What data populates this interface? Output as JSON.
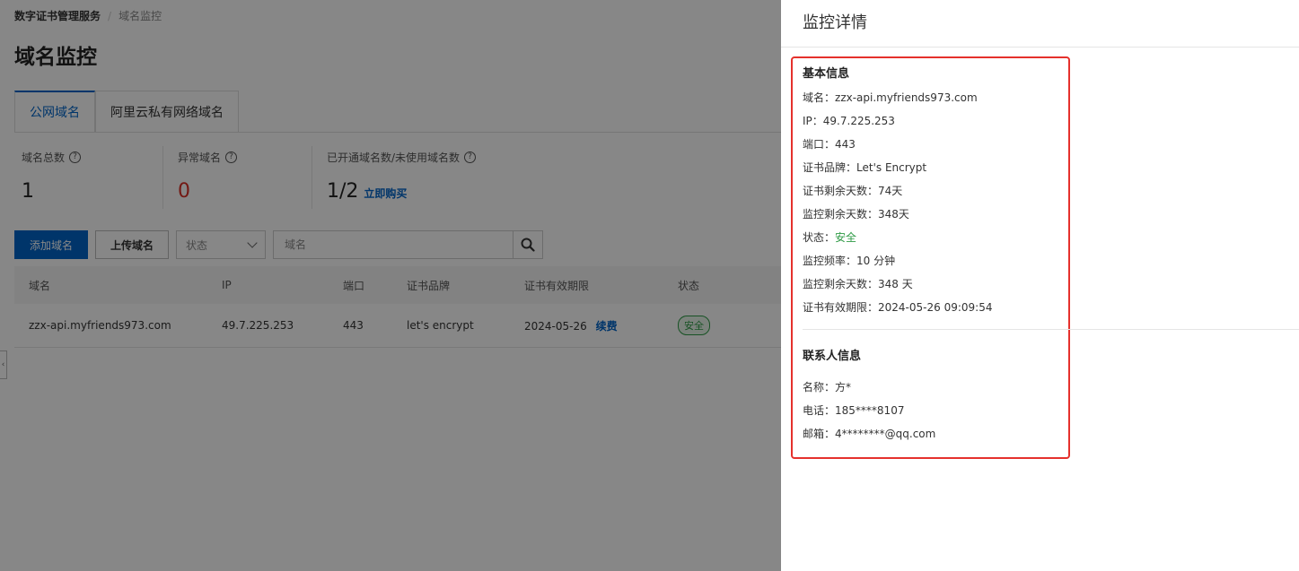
{
  "breadcrumb": {
    "root": "数字证书管理服务",
    "separator": "/",
    "current": "域名监控"
  },
  "page_title": "域名监控",
  "tabs": [
    {
      "label": "公网域名",
      "active": true
    },
    {
      "label": "阿里云私有网络域名",
      "active": false
    }
  ],
  "stats": [
    {
      "label": "域名总数",
      "value": "1"
    },
    {
      "label": "异常域名",
      "value": "0"
    },
    {
      "label": "已开通域名数/未使用域名数",
      "value": "1/2",
      "link": "立即购买"
    }
  ],
  "toolbar": {
    "add_label": "添加域名",
    "upload_label": "上传域名",
    "status_select": "状态",
    "search_placeholder": "域名"
  },
  "table": {
    "headers": [
      "域名",
      "IP",
      "端口",
      "证书品牌",
      "证书有效期限",
      "状态"
    ],
    "rows": [
      {
        "domain": "zzx-api.myfriends973.com",
        "ip": "49.7.225.253",
        "port": "443",
        "brand": "let's encrypt",
        "expiry": "2024-05-26",
        "renew": "续费",
        "status": "安全"
      }
    ]
  },
  "drawer": {
    "title": "监控详情",
    "basic_title": "基本信息",
    "basic": [
      {
        "label": "域名：",
        "value": "zzx-api.myfriends973.com"
      },
      {
        "label": "IP：",
        "value": "49.7.225.253"
      },
      {
        "label": "端口：",
        "value": "443"
      },
      {
        "label": "证书品牌：",
        "value": "Let's Encrypt"
      },
      {
        "label": "证书剩余天数：",
        "value": "74天"
      },
      {
        "label": "监控剩余天数：",
        "value": "348天"
      },
      {
        "label": "状态：",
        "value": "安全"
      },
      {
        "label": "监控频率：",
        "value": "10 分钟"
      },
      {
        "label": "监控剩余天数：",
        "value": "348 天"
      },
      {
        "label": "证书有效期限：",
        "value": "2024-05-26 09:09:54"
      }
    ],
    "contact_title": "联系人信息",
    "contact": [
      {
        "label": "名称：",
        "value": "方*"
      },
      {
        "label": "电话：",
        "value": "185****8107"
      },
      {
        "label": "邮箱：",
        "value": "4********@qq.com"
      }
    ]
  },
  "colors": {
    "primary": "#0064c8",
    "danger": "#d93026",
    "success": "#2f9b46",
    "highlight": "#e5312c"
  }
}
